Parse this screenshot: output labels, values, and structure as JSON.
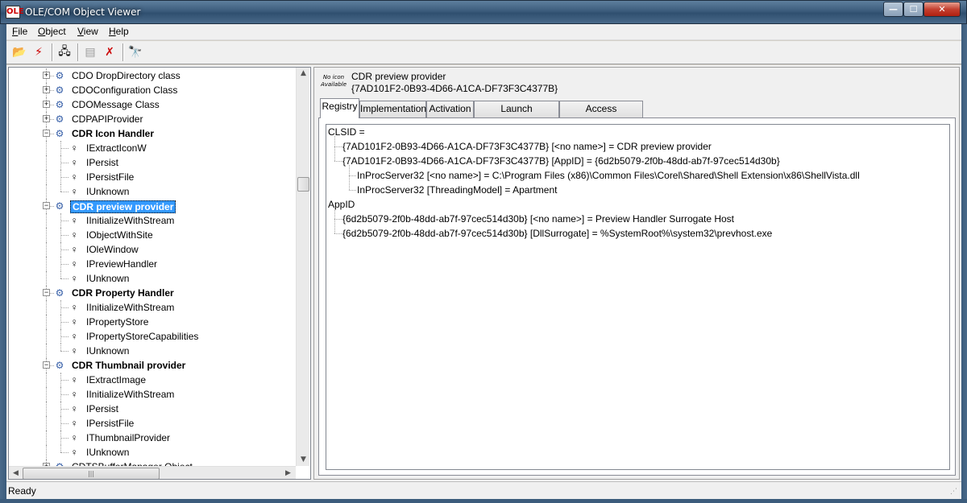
{
  "window": {
    "title": "OLE/COM Object Viewer",
    "app_icon": "OLE",
    "min_glyph": "—",
    "max_glyph": "☐",
    "close_glyph": "✕"
  },
  "menu": [
    "File",
    "Object",
    "View",
    "Help"
  ],
  "toolbar": [
    {
      "name": "open-icon",
      "glyph": "📂"
    },
    {
      "name": "bind-icon",
      "glyph": "⚡"
    },
    {
      "name": "expert-mode-icon",
      "glyph": "🖧"
    },
    {
      "name": "create-instance-icon",
      "glyph": "▤"
    },
    {
      "name": "release-instance-icon",
      "glyph": "✗"
    },
    {
      "name": "view-typelib-icon",
      "glyph": "🔭"
    }
  ],
  "tree": {
    "rows": [
      {
        "label": "CDO DropDirectory class",
        "level": 0,
        "type": "class",
        "bold": false,
        "expander": "+"
      },
      {
        "label": "CDOConfiguration Class",
        "level": 0,
        "type": "class",
        "bold": false,
        "expander": "+"
      },
      {
        "label": "CDOMessage Class",
        "level": 0,
        "type": "class",
        "bold": false,
        "expander": "+"
      },
      {
        "label": "CDPAPIProvider",
        "level": 0,
        "type": "class",
        "bold": false,
        "expander": "+"
      },
      {
        "label": "CDR Icon Handler",
        "level": 0,
        "type": "class",
        "bold": true,
        "expander": "−"
      },
      {
        "label": "IExtractIconW",
        "level": 1,
        "type": "interface"
      },
      {
        "label": "IPersist",
        "level": 1,
        "type": "interface"
      },
      {
        "label": "IPersistFile",
        "level": 1,
        "type": "interface"
      },
      {
        "label": "IUnknown",
        "level": 1,
        "type": "interface"
      },
      {
        "label": "CDR preview provider",
        "level": 0,
        "type": "class",
        "bold": true,
        "expander": "−",
        "selected": true
      },
      {
        "label": "IInitializeWithStream",
        "level": 1,
        "type": "interface"
      },
      {
        "label": "IObjectWithSite",
        "level": 1,
        "type": "interface"
      },
      {
        "label": "IOleWindow",
        "level": 1,
        "type": "interface"
      },
      {
        "label": "IPreviewHandler",
        "level": 1,
        "type": "interface"
      },
      {
        "label": "IUnknown",
        "level": 1,
        "type": "interface"
      },
      {
        "label": "CDR Property Handler",
        "level": 0,
        "type": "class",
        "bold": true,
        "expander": "−"
      },
      {
        "label": "IInitializeWithStream",
        "level": 1,
        "type": "interface"
      },
      {
        "label": "IPropertyStore",
        "level": 1,
        "type": "interface"
      },
      {
        "label": "IPropertyStoreCapabilities",
        "level": 1,
        "type": "interface"
      },
      {
        "label": "IUnknown",
        "level": 1,
        "type": "interface"
      },
      {
        "label": "CDR Thumbnail provider",
        "level": 0,
        "type": "class",
        "bold": true,
        "expander": "−"
      },
      {
        "label": "IExtractImage",
        "level": 1,
        "type": "interface"
      },
      {
        "label": "IInitializeWithStream",
        "level": 1,
        "type": "interface"
      },
      {
        "label": "IPersist",
        "level": 1,
        "type": "interface"
      },
      {
        "label": "IPersistFile",
        "level": 1,
        "type": "interface"
      },
      {
        "label": "IThumbnailProvider",
        "level": 1,
        "type": "interface"
      },
      {
        "label": "IUnknown",
        "level": 1,
        "type": "interface"
      },
      {
        "label": "CDTSBufferManager Object",
        "level": 0,
        "type": "class",
        "bold": false,
        "expander": "+"
      }
    ]
  },
  "detail": {
    "noicon_text": "No icon Available",
    "name": "CDR preview provider",
    "clsid": "{7AD101F2-0B93-4D66-A1CA-DF73F3C4377B}",
    "tabs": [
      "Registry",
      "Implementation",
      "Activation",
      "Launch Permissions",
      "Access Permissions"
    ],
    "active_tab": "Registry",
    "registry": [
      {
        "text": "CLSID =",
        "level": 0
      },
      {
        "text": "{7AD101F2-0B93-4D66-A1CA-DF73F3C4377B} [<no name>] = CDR preview provider",
        "level": 1
      },
      {
        "text": "{7AD101F2-0B93-4D66-A1CA-DF73F3C4377B} [AppID] = {6d2b5079-2f0b-48dd-ab7f-97cec514d30b}",
        "level": 1
      },
      {
        "text": "InProcServer32 [<no name>] = C:\\Program Files (x86)\\Common Files\\Corel\\Shared\\Shell Extension\\x86\\ShellVista.dll",
        "level": 2
      },
      {
        "text": "InProcServer32 [ThreadingModel] = Apartment",
        "level": 2
      },
      {
        "text": "AppID",
        "level": 0
      },
      {
        "text": "{6d2b5079-2f0b-48dd-ab7f-97cec514d30b} [<no name>] = Preview Handler Surrogate Host",
        "level": 1
      },
      {
        "text": "{6d2b5079-2f0b-48dd-ab7f-97cec514d30b} [DllSurrogate] = %SystemRoot%\\system32\\prevhost.exe",
        "level": 1
      }
    ]
  },
  "status": {
    "text": "Ready"
  }
}
